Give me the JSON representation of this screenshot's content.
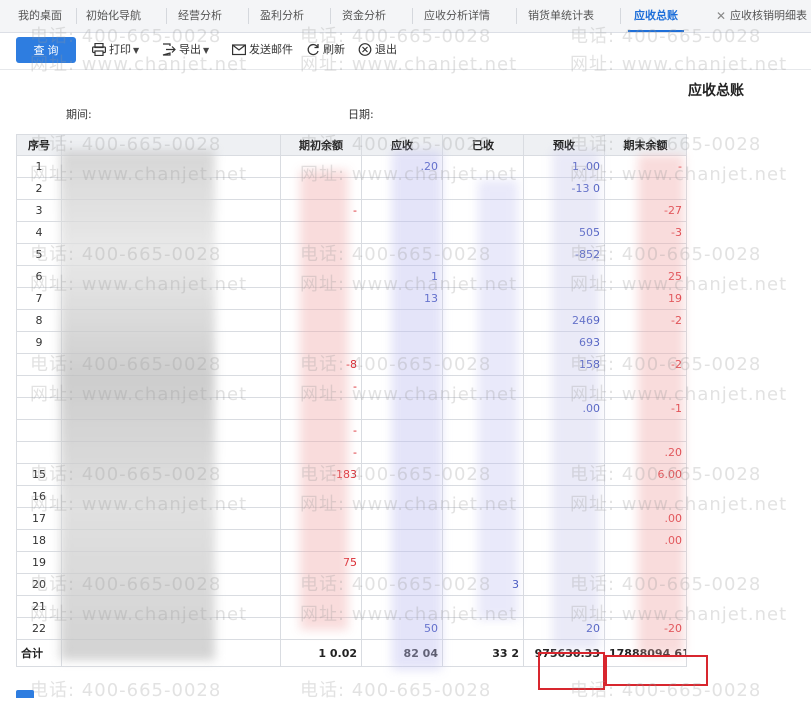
{
  "tabs": [
    {
      "label": "我的桌面"
    },
    {
      "label": "初始化导航"
    },
    {
      "label": "经营分析"
    },
    {
      "label": "盈利分析"
    },
    {
      "label": "资金分析"
    },
    {
      "label": "应收分析详情"
    },
    {
      "label": "销货单统计表"
    },
    {
      "label": "应收总账",
      "active": true
    },
    {
      "label": "应收核销明细表"
    }
  ],
  "tab_close_glyph": "✕",
  "toolbar": {
    "query": "查 询",
    "print": "打印",
    "export": "导出",
    "email": "发送邮件",
    "refresh": "刷新",
    "exit": "退出"
  },
  "report": {
    "title": "应收总账",
    "period_label": "期间:",
    "date_label": "日期:"
  },
  "table": {
    "columns": [
      "序号",
      "",
      "期初余额",
      "应收",
      "已收",
      "预收",
      "期末余额"
    ],
    "rows": [
      {
        "seq": "1",
        "opening": "",
        "receivable": ".20",
        "received": "",
        "advance": "1  .00",
        "closing": "-"
      },
      {
        "seq": "2",
        "opening": "",
        "receivable": "",
        "received": "",
        "advance": "-13    0",
        "closing": ""
      },
      {
        "seq": "3",
        "opening": "-",
        "receivable": "",
        "received": "",
        "advance": "",
        "closing": "-27"
      },
      {
        "seq": "4",
        "opening": "",
        "receivable": "",
        "received": "",
        "advance": "505",
        "closing": "-3"
      },
      {
        "seq": "5",
        "opening": "",
        "receivable": "",
        "received": "",
        "advance": "-852",
        "closing": ""
      },
      {
        "seq": "6",
        "opening": "",
        "receivable": "1",
        "received": "",
        "advance": "",
        "closing": "25"
      },
      {
        "seq": "7",
        "opening": "",
        "receivable": "13",
        "received": "",
        "advance": "",
        "closing": "19"
      },
      {
        "seq": "8",
        "opening": "",
        "receivable": "",
        "received": "",
        "advance": "2469",
        "closing": "-2"
      },
      {
        "seq": "9",
        "opening": "",
        "receivable": "",
        "received": "",
        "advance": "693",
        "closing": ""
      },
      {
        "seq": "",
        "opening": "-8",
        "receivable": "",
        "received": "",
        "advance": "158",
        "closing": "-2"
      },
      {
        "seq": "",
        "opening": "-",
        "receivable": "",
        "received": "",
        "advance": "",
        "closing": ""
      },
      {
        "seq": "",
        "opening": "",
        "receivable": "",
        "received": "",
        "advance": "  .00",
        "closing": "-1"
      },
      {
        "seq": "",
        "opening": "-",
        "receivable": "",
        "received": "",
        "advance": "",
        "closing": ""
      },
      {
        "seq": "",
        "opening": "-",
        "receivable": "",
        "received": "",
        "advance": "",
        "closing": ".20"
      },
      {
        "seq": "15",
        "opening": "-183",
        "receivable": "",
        "received": "",
        "advance": "",
        "closing": "6.00"
      },
      {
        "seq": "16",
        "opening": "",
        "receivable": "",
        "received": "",
        "advance": "",
        "closing": ""
      },
      {
        "seq": "17",
        "opening": "",
        "receivable": "",
        "received": "",
        "advance": "",
        "closing": ".00"
      },
      {
        "seq": "18",
        "opening": "",
        "receivable": "",
        "received": "",
        "advance": "",
        "closing": ".00"
      },
      {
        "seq": "19",
        "opening": "75",
        "receivable": "",
        "received": "",
        "advance": "",
        "closing": ""
      },
      {
        "seq": "20",
        "opening": "",
        "receivable": "",
        "received": "3",
        "advance": "",
        "closing": ""
      },
      {
        "seq": "21",
        "opening": "",
        "receivable": "",
        "received": "",
        "advance": "",
        "closing": ""
      },
      {
        "seq": "22",
        "opening": "",
        "receivable": "50",
        "received": "",
        "advance": "20",
        "closing": "-20"
      }
    ],
    "total": {
      "label": "合计",
      "opening": "1        0.02",
      "receivable": "82      04",
      "received": "33        2",
      "advance": "975630.33",
      "closing": "17888094.61"
    }
  },
  "watermark": {
    "phone": "电话: 400-665-0028",
    "site": "网址: www.chanjet.net"
  },
  "colors": {
    "accent": "#1e6fd9",
    "negative": "#d9232b",
    "highlight": "#d8262e"
  }
}
